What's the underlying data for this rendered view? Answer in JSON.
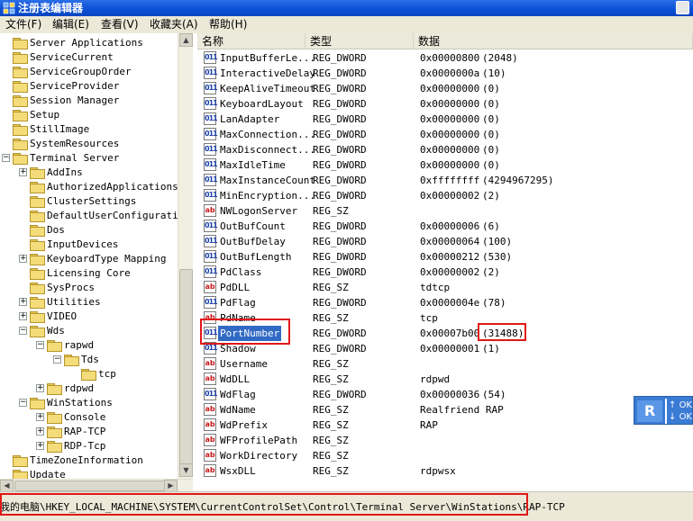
{
  "window": {
    "title": "注册表编辑器"
  },
  "menu": [
    "文件(F)",
    "编辑(E)",
    "查看(V)",
    "收藏夹(A)",
    "帮助(H)"
  ],
  "tree": [
    {
      "label": "Server Applications",
      "level": 0,
      "expander": ""
    },
    {
      "label": "ServiceCurrent",
      "level": 0,
      "expander": ""
    },
    {
      "label": "ServiceGroupOrder",
      "level": 0,
      "expander": ""
    },
    {
      "label": "ServiceProvider",
      "level": 0,
      "expander": ""
    },
    {
      "label": "Session Manager",
      "level": 0,
      "expander": ""
    },
    {
      "label": "Setup",
      "level": 0,
      "expander": ""
    },
    {
      "label": "StillImage",
      "level": 0,
      "expander": ""
    },
    {
      "label": "SystemResources",
      "level": 0,
      "expander": ""
    },
    {
      "label": "Terminal Server",
      "level": 0,
      "expander": "-"
    },
    {
      "label": "AddIns",
      "level": 1,
      "expander": "+"
    },
    {
      "label": "AuthorizedApplications",
      "level": 1,
      "expander": ""
    },
    {
      "label": "ClusterSettings",
      "level": 1,
      "expander": ""
    },
    {
      "label": "DefaultUserConfiguration",
      "level": 1,
      "expander": ""
    },
    {
      "label": "Dos",
      "level": 1,
      "expander": ""
    },
    {
      "label": "InputDevices",
      "level": 1,
      "expander": ""
    },
    {
      "label": "KeyboardType Mapping",
      "level": 1,
      "expander": "+"
    },
    {
      "label": "Licensing Core",
      "level": 1,
      "expander": ""
    },
    {
      "label": "SysProcs",
      "level": 1,
      "expander": ""
    },
    {
      "label": "Utilities",
      "level": 1,
      "expander": "+"
    },
    {
      "label": "VIDEO",
      "level": 1,
      "expander": "+"
    },
    {
      "label": "Wds",
      "level": 1,
      "expander": "-"
    },
    {
      "label": "rapwd",
      "level": 2,
      "expander": "-"
    },
    {
      "label": "Tds",
      "level": 3,
      "expander": "-"
    },
    {
      "label": "tcp",
      "level": 4,
      "expander": ""
    },
    {
      "label": "rdpwd",
      "level": 2,
      "expander": "+"
    },
    {
      "label": "WinStations",
      "level": 1,
      "expander": "-"
    },
    {
      "label": "Console",
      "level": 2,
      "expander": "+"
    },
    {
      "label": "RAP-TCP",
      "level": 2,
      "expander": "+"
    },
    {
      "label": "RDP-Tcp",
      "level": 2,
      "expander": "+"
    },
    {
      "label": "TimeZoneInformation",
      "level": 0,
      "expander": ""
    },
    {
      "label": "Update",
      "level": 0,
      "expander": ""
    }
  ],
  "columns": {
    "name": "名称",
    "type": "类型",
    "data": "数据"
  },
  "rows": [
    {
      "name": "InputBufferLe...",
      "type": "REG_DWORD",
      "data": "0x00000800",
      "paren": "(2048)",
      "kind": "bin"
    },
    {
      "name": "InteractiveDelay",
      "type": "REG_DWORD",
      "data": "0x0000000a",
      "paren": "(10)",
      "kind": "bin"
    },
    {
      "name": "KeepAliveTimeout",
      "type": "REG_DWORD",
      "data": "0x00000000",
      "paren": "(0)",
      "kind": "bin"
    },
    {
      "name": "KeyboardLayout",
      "type": "REG_DWORD",
      "data": "0x00000000",
      "paren": "(0)",
      "kind": "bin"
    },
    {
      "name": "LanAdapter",
      "type": "REG_DWORD",
      "data": "0x00000000",
      "paren": "(0)",
      "kind": "bin"
    },
    {
      "name": "MaxConnection...",
      "type": "REG_DWORD",
      "data": "0x00000000",
      "paren": "(0)",
      "kind": "bin"
    },
    {
      "name": "MaxDisconnect...",
      "type": "REG_DWORD",
      "data": "0x00000000",
      "paren": "(0)",
      "kind": "bin"
    },
    {
      "name": "MaxIdleTime",
      "type": "REG_DWORD",
      "data": "0x00000000",
      "paren": "(0)",
      "kind": "bin"
    },
    {
      "name": "MaxInstanceCount",
      "type": "REG_DWORD",
      "data": "0xffffffff",
      "paren": "(4294967295)",
      "kind": "bin"
    },
    {
      "name": "MinEncryption...",
      "type": "REG_DWORD",
      "data": "0x00000002",
      "paren": "(2)",
      "kind": "bin"
    },
    {
      "name": "NWLogonServer",
      "type": "REG_SZ",
      "data": "",
      "paren": "",
      "kind": "sz"
    },
    {
      "name": "OutBufCount",
      "type": "REG_DWORD",
      "data": "0x00000006",
      "paren": "(6)",
      "kind": "bin"
    },
    {
      "name": "OutBufDelay",
      "type": "REG_DWORD",
      "data": "0x00000064",
      "paren": "(100)",
      "kind": "bin"
    },
    {
      "name": "OutBufLength",
      "type": "REG_DWORD",
      "data": "0x00000212",
      "paren": "(530)",
      "kind": "bin"
    },
    {
      "name": "PdClass",
      "type": "REG_DWORD",
      "data": "0x00000002",
      "paren": "(2)",
      "kind": "bin"
    },
    {
      "name": "PdDLL",
      "type": "REG_SZ",
      "data": "tdtcp",
      "paren": "",
      "kind": "sz"
    },
    {
      "name": "PdFlag",
      "type": "REG_DWORD",
      "data": "0x0000004e",
      "paren": "(78)",
      "kind": "bin"
    },
    {
      "name": "PdName",
      "type": "REG_SZ",
      "data": "tcp",
      "paren": "",
      "kind": "sz"
    },
    {
      "name": "PortNumber",
      "type": "REG_DWORD",
      "data": "0x00007b00",
      "paren": "(31488)",
      "kind": "bin",
      "selected": true
    },
    {
      "name": "Shadow",
      "type": "REG_DWORD",
      "data": "0x00000001",
      "paren": "(1)",
      "kind": "bin"
    },
    {
      "name": "Username",
      "type": "REG_SZ",
      "data": "",
      "paren": "",
      "kind": "sz"
    },
    {
      "name": "WdDLL",
      "type": "REG_SZ",
      "data": "rdpwd",
      "paren": "",
      "kind": "sz"
    },
    {
      "name": "WdFlag",
      "type": "REG_DWORD",
      "data": "0x00000036",
      "paren": "(54)",
      "kind": "bin"
    },
    {
      "name": "WdName",
      "type": "REG_SZ",
      "data": "Realfriend RAP",
      "paren": "",
      "kind": "sz"
    },
    {
      "name": "WdPrefix",
      "type": "REG_SZ",
      "data": "RAP",
      "paren": "",
      "kind": "sz"
    },
    {
      "name": "WFProfilePath",
      "type": "REG_SZ",
      "data": "",
      "paren": "",
      "kind": "sz"
    },
    {
      "name": "WorkDirectory",
      "type": "REG_SZ",
      "data": "",
      "paren": "",
      "kind": "sz"
    },
    {
      "name": "WsxDLL",
      "type": "REG_SZ",
      "data": "rdpwsx",
      "paren": "",
      "kind": "sz"
    }
  ],
  "icons": {
    "bin": "011",
    "sz": "ab"
  },
  "status": {
    "path": "我的电脑\\HKEY_LOCAL_MACHINE\\SYSTEM\\CurrentControlSet\\Control\\Terminal Server\\WinStations\\RAP-TCP"
  },
  "tray": {
    "icon": "R",
    "line1": "OKE",
    "line2": "OKE"
  },
  "colors": {
    "title_bar": "#0b4fd4",
    "selection": "#316ac5",
    "highlight_box": "#e01818"
  }
}
